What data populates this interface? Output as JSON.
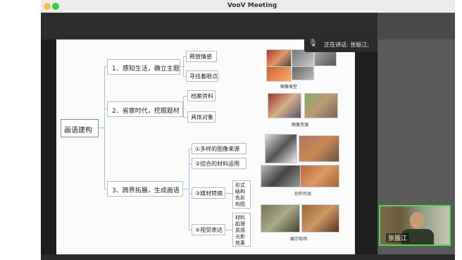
{
  "window": {
    "title": "VooV Meeting"
  },
  "speaking_indicator": {
    "text": "正在讲话: 张振江;"
  },
  "participant": {
    "name": "张振江"
  },
  "slide": {
    "root": "画语建构",
    "branches": [
      {
        "label": "1、感知生活，确立主题",
        "children": [
          "释放情感",
          "寻找着眼点"
        ]
      },
      {
        "label": "2、省察时代，挖掘题材",
        "children": [
          "档案资料",
          "具体对象"
        ]
      },
      {
        "label": "3、跨界拓展，生成画语",
        "children": [
          "①多样的图像来源",
          "②综合的材料运用",
          "③媒材转换",
          "④视觉表达"
        ]
      }
    ],
    "details": {
      "media": "形式 结构 色彩 构图",
      "visual": "材料 肌理 质感 光影 效果"
    },
    "captions": [
      "图像类型",
      "图像资源",
      "创作作品",
      "展示现场"
    ]
  }
}
